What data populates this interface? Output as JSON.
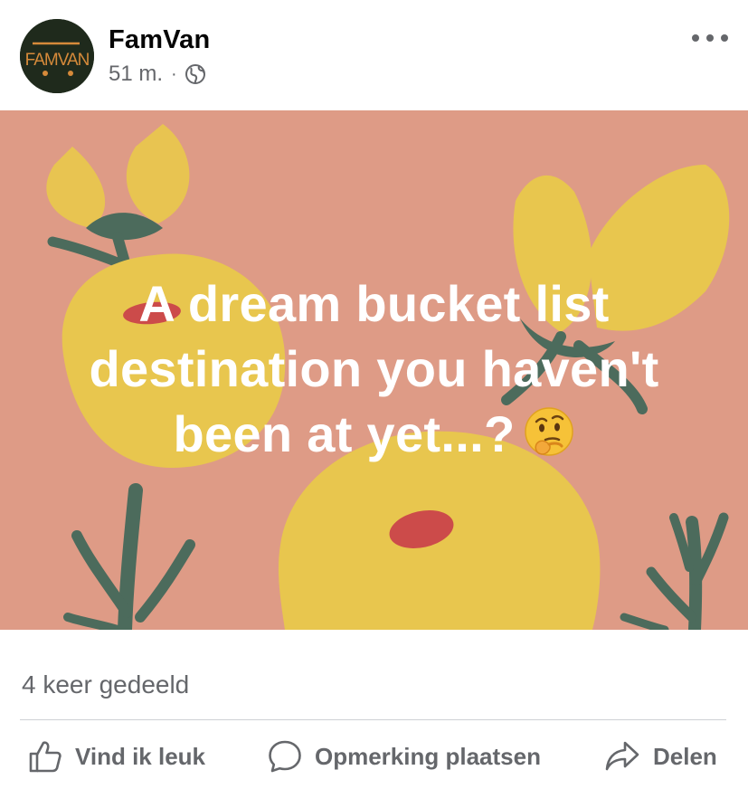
{
  "post": {
    "page_name": "FamVan",
    "avatar_logo_text": "FAMVAN",
    "time": "51 m.",
    "separator": "·",
    "audience_icon": "globe-icon",
    "more_icon": "more-horizontal-icon",
    "image_text_lines": [
      "A dream bucket list",
      "destination you haven't",
      "been at yet...?"
    ],
    "image_emoji": "thinking-face-emoji",
    "share_count": "4 keer gedeeld"
  },
  "actions": {
    "like_label": "Vind ik leuk",
    "like_icon": "thumbs-up-icon",
    "comment_label": "Opmerking plaatsen",
    "comment_icon": "comment-bubble-icon",
    "share_label": "Delen",
    "share_icon": "share-arrow-icon"
  },
  "colors": {
    "image_background": "#de9b86",
    "flower_yellow": "#e8c64e",
    "stem_green": "#4c6b5c",
    "secondary_text": "#65676b",
    "avatar_bg": "#1f2a1c",
    "logo_orange": "#d68a3a"
  }
}
